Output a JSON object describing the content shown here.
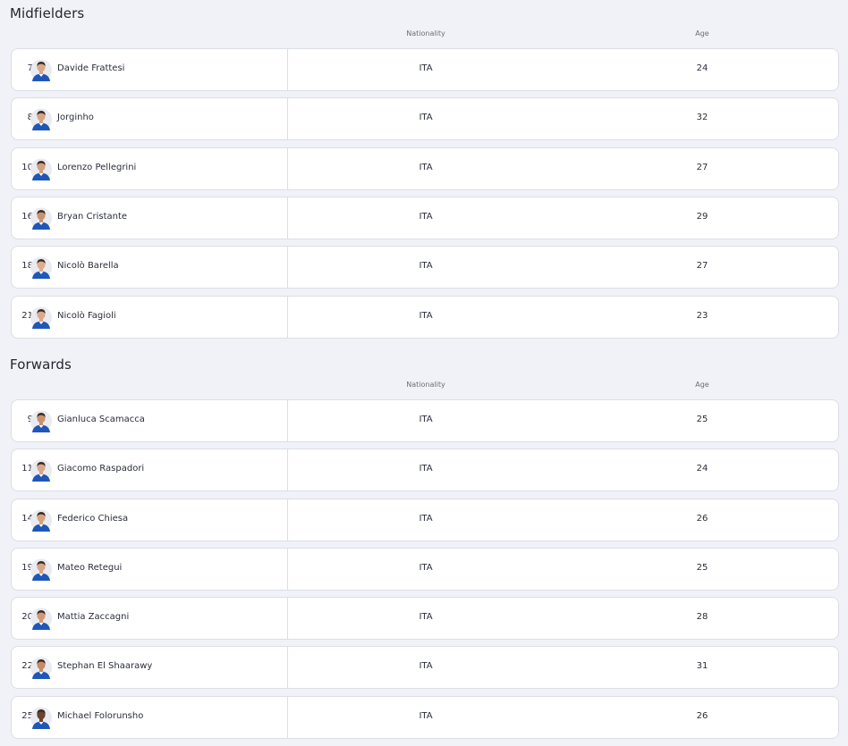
{
  "sections": [
    {
      "title": "Midfielders",
      "nationality_header": "Nationality",
      "age_header": "Age",
      "players": [
        {
          "number": "7",
          "name": "Davide Frattesi",
          "nationality": "ITA",
          "age": "24"
        },
        {
          "number": "8",
          "name": "Jorginho",
          "nationality": "ITA",
          "age": "32"
        },
        {
          "number": "10",
          "name": "Lorenzo Pellegrini",
          "nationality": "ITA",
          "age": "27"
        },
        {
          "number": "16",
          "name": "Bryan Cristante",
          "nationality": "ITA",
          "age": "29"
        },
        {
          "number": "18",
          "name": "Nicolò Barella",
          "nationality": "ITA",
          "age": "27"
        },
        {
          "number": "21",
          "name": "Nicolò Fagioli",
          "nationality": "ITA",
          "age": "23"
        }
      ]
    },
    {
      "title": "Forwards",
      "nationality_header": "Nationality",
      "age_header": "Age",
      "players": [
        {
          "number": "9",
          "name": "Gianluca Scamacca",
          "nationality": "ITA",
          "age": "25"
        },
        {
          "number": "11",
          "name": "Giacomo Raspadori",
          "nationality": "ITA",
          "age": "24"
        },
        {
          "number": "14",
          "name": "Federico Chiesa",
          "nationality": "ITA",
          "age": "26"
        },
        {
          "number": "19",
          "name": "Mateo Retegui",
          "nationality": "ITA",
          "age": "25"
        },
        {
          "number": "20",
          "name": "Mattia Zaccagni",
          "nationality": "ITA",
          "age": "28"
        },
        {
          "number": "22",
          "name": "Stephan El Shaarawy",
          "nationality": "ITA",
          "age": "31"
        },
        {
          "number": "25",
          "name": "Michael Folorunsho",
          "nationality": "ITA",
          "age": "26"
        }
      ]
    }
  ],
  "avatar_icon": "player-photo-icon",
  "colors": {
    "background": "#f1f2f7",
    "card": "#ffffff",
    "border": "#dcdee6",
    "kit_blue": "#1f57b8",
    "hair": "#3b2a20"
  }
}
